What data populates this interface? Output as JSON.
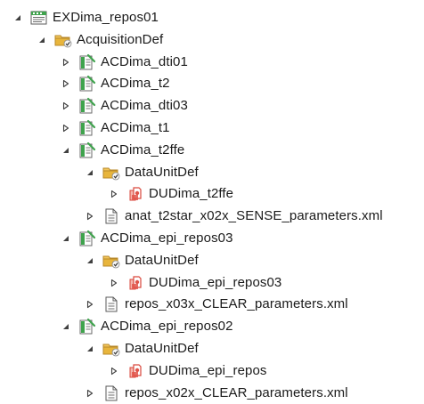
{
  "tree": [
    {
      "label": "EXDima_repos01",
      "depth": 0,
      "state": "expanded",
      "icon": "study-icon"
    },
    {
      "label": "AcquisitionDef",
      "depth": 1,
      "state": "expanded",
      "icon": "folder-icon"
    },
    {
      "label": "ACDima_dti01",
      "depth": 2,
      "state": "collapsed",
      "icon": "acquisition-icon"
    },
    {
      "label": "ACDima_t2",
      "depth": 2,
      "state": "collapsed",
      "icon": "acquisition-icon"
    },
    {
      "label": "ACDima_dti03",
      "depth": 2,
      "state": "collapsed",
      "icon": "acquisition-icon"
    },
    {
      "label": "ACDima_t1",
      "depth": 2,
      "state": "collapsed",
      "icon": "acquisition-icon"
    },
    {
      "label": "ACDima_t2ffe",
      "depth": 2,
      "state": "expanded",
      "icon": "acquisition-icon"
    },
    {
      "label": "DataUnitDef",
      "depth": 3,
      "state": "expanded",
      "icon": "folder-icon"
    },
    {
      "label": "DUDima_t2ffe",
      "depth": 4,
      "state": "collapsed",
      "icon": "dataunit-icon"
    },
    {
      "label": "anat_t2star_x02x_SENSE_parameters.xml",
      "depth": 3,
      "state": "collapsed",
      "icon": "file-icon"
    },
    {
      "label": "ACDima_epi_repos03",
      "depth": 2,
      "state": "expanded",
      "icon": "acquisition-icon"
    },
    {
      "label": "DataUnitDef",
      "depth": 3,
      "state": "expanded",
      "icon": "folder-icon"
    },
    {
      "label": "DUDima_epi_repos03",
      "depth": 4,
      "state": "collapsed",
      "icon": "dataunit-icon"
    },
    {
      "label": "repos_x03x_CLEAR_parameters.xml",
      "depth": 3,
      "state": "collapsed",
      "icon": "file-icon"
    },
    {
      "label": "ACDima_epi_repos02",
      "depth": 2,
      "state": "expanded",
      "icon": "acquisition-icon"
    },
    {
      "label": "DataUnitDef",
      "depth": 3,
      "state": "expanded",
      "icon": "folder-icon"
    },
    {
      "label": "DUDima_epi_repos",
      "depth": 4,
      "state": "collapsed",
      "icon": "dataunit-icon"
    },
    {
      "label": "repos_x02x_CLEAR_parameters.xml",
      "depth": 3,
      "state": "collapsed",
      "icon": "file-icon"
    }
  ],
  "colors": {
    "text": "#1a1a1a",
    "arrow": "#404040",
    "folder": "#e8b53c",
    "accent_green": "#3fa34d",
    "dataunit": "#e0554a"
  }
}
